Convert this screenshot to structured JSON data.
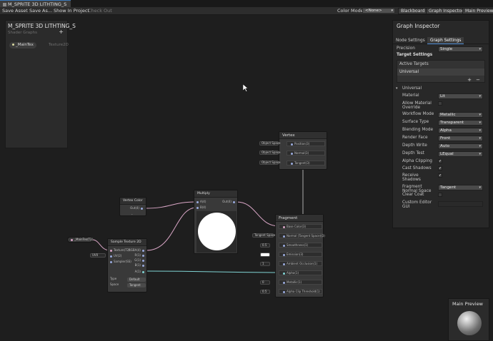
{
  "window": {
    "tab_title": "M_SPRITE 3D LITHTING_S"
  },
  "toolbar": {
    "save_asset": "Save Asset",
    "save_as": "Save As...",
    "show_in_project": "Show In Project",
    "check_out": "Check Out",
    "color_mode_label": "Color Mode",
    "color_mode_value": "<None>",
    "blackboard": "Blackboard",
    "graph_inspector": "Graph Inspector",
    "main_preview": "Main Preview"
  },
  "blackboard": {
    "title": "M_SPRITE 3D LITHTING_S",
    "subtitle": "Shader Graphs",
    "property_name": "_MainTex",
    "property_type": "Texture2D"
  },
  "nodes": {
    "vertex": {
      "title": "Vertex",
      "ports": [
        "Position(3)",
        "Normal(3)",
        "Tangent(3)"
      ],
      "spaces": [
        "Object Space",
        "Object Space",
        "Object Space"
      ]
    },
    "vertex_color": {
      "title": "Vertex Color",
      "out": "Out(4)"
    },
    "multiply": {
      "title": "Multiply",
      "in_a": "A(4)",
      "in_b": "B(4)",
      "out": "Out(4)"
    },
    "property": {
      "label": "_MainTex(T2)"
    },
    "uv_label": "UV0",
    "sample": {
      "title": "Sample Texture 2D",
      "inputs": [
        "Texture(T2)",
        "UV(2)",
        "Sampler(SS)"
      ],
      "outputs": [
        "RGBA(4)",
        "R(1)",
        "G(1)",
        "B(1)",
        "A(1)"
      ],
      "type_label": "Type",
      "type_value": "Default",
      "space_label": "Space",
      "space_value": "Tangent"
    },
    "fragment": {
      "title": "Fragment",
      "ports": [
        "Base Color(3)",
        "Normal (Tangent Space)(3)",
        "Smoothness(1)",
        "Emission(3)",
        "Ambient Occlusion(1)",
        "Alpha(1)",
        "Metallic(1)",
        "Alpha Clip Threshold(1)"
      ],
      "tangent_space": "Tangent Space",
      "values": [
        "0.5",
        "",
        "1",
        "0",
        "0",
        "0.5"
      ]
    }
  },
  "inspector": {
    "title": "Graph Inspector",
    "tabs": [
      "Node Settings",
      "Graph Settings"
    ],
    "precision_label": "Precision",
    "precision_value": "Single",
    "target_settings": "Target Settings",
    "active_targets": "Active Targets",
    "universal_item": "Universal",
    "list_add": "+",
    "list_remove": "−",
    "section": "Universal",
    "settings": [
      {
        "label": "Material",
        "value": "Lit",
        "kind": "dropdown"
      },
      {
        "label": "Allow Material Override",
        "value": "",
        "kind": "check"
      },
      {
        "label": "Workflow Mode",
        "value": "Metallic",
        "kind": "dropdown"
      },
      {
        "label": "Surface Type",
        "value": "Transparent",
        "kind": "dropdown"
      },
      {
        "label": "Blending Mode",
        "value": "Alpha",
        "kind": "dropdown"
      },
      {
        "label": "Render Face",
        "value": "Front",
        "kind": "dropdown"
      },
      {
        "label": "Depth Write",
        "value": "Auto",
        "kind": "dropdown"
      },
      {
        "label": "Depth Test",
        "value": "LEqual",
        "kind": "dropdown"
      },
      {
        "label": "Alpha Clipping",
        "value": "✓",
        "kind": "check"
      },
      {
        "label": "Cast Shadows",
        "value": "✓",
        "kind": "check"
      },
      {
        "label": "Receive Shadows",
        "value": "✓",
        "kind": "check"
      },
      {
        "label": "Fragment Normal Space",
        "value": "Tangent",
        "kind": "dropdown"
      },
      {
        "label": "Clear Coat",
        "value": "",
        "kind": "check"
      },
      {
        "label": "Custom Editor GUI",
        "value": "",
        "kind": "text"
      }
    ]
  },
  "preview": {
    "title": "Main Preview"
  },
  "colors": {
    "accent": "#4b8bd4",
    "wire_pink": "#d9a6c6",
    "wire_cyan": "#7fd3d3",
    "wire_white": "#d0d0d0"
  }
}
